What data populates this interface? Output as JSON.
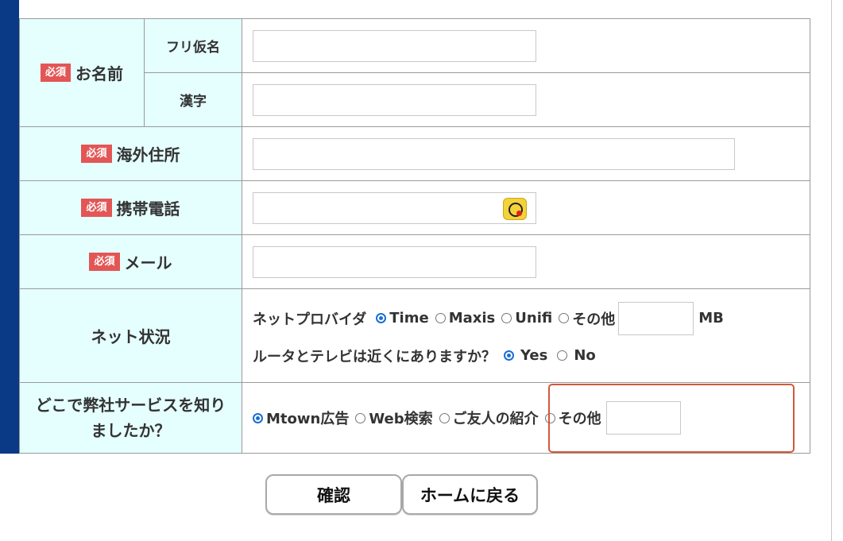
{
  "name": {
    "required_badge": "必須",
    "label": "お名前",
    "furigana_label": "フリ仮名",
    "kanji_label": "漢字",
    "furigana_value": "",
    "kanji_value": ""
  },
  "address": {
    "required_badge": "必須",
    "label": "海外住所",
    "value": ""
  },
  "phone": {
    "required_badge": "必須",
    "label": "携帯電話",
    "value": ""
  },
  "email": {
    "required_badge": "必須",
    "label": "メール",
    "value": ""
  },
  "net": {
    "label": "ネット状況",
    "provider_label": "ネットプロバイダ",
    "provider_options": [
      "Time",
      "Maxis",
      "Unifi",
      "その他"
    ],
    "provider_selected": "Time",
    "other_value": "",
    "unit": "MB",
    "router_question": "ルータとテレビは近くにありますか？",
    "router_options": [
      "Yes",
      "No"
    ],
    "router_selected": "Yes"
  },
  "source": {
    "label": "どこで弊社サービスを知りましたか？",
    "options": [
      "Mtown広告",
      "Web検索",
      "ご友人の紹介",
      "その他"
    ],
    "selected": "Mtown広告",
    "other_value": ""
  },
  "buttons": {
    "confirm": "確認",
    "home": "ホームに戻る"
  },
  "colors": {
    "left_bar": "#0a3a86",
    "label_bg": "#e5fefe",
    "required": "#e35656",
    "highlight": "#d2583a",
    "radio_on": "#1a6fd1"
  }
}
